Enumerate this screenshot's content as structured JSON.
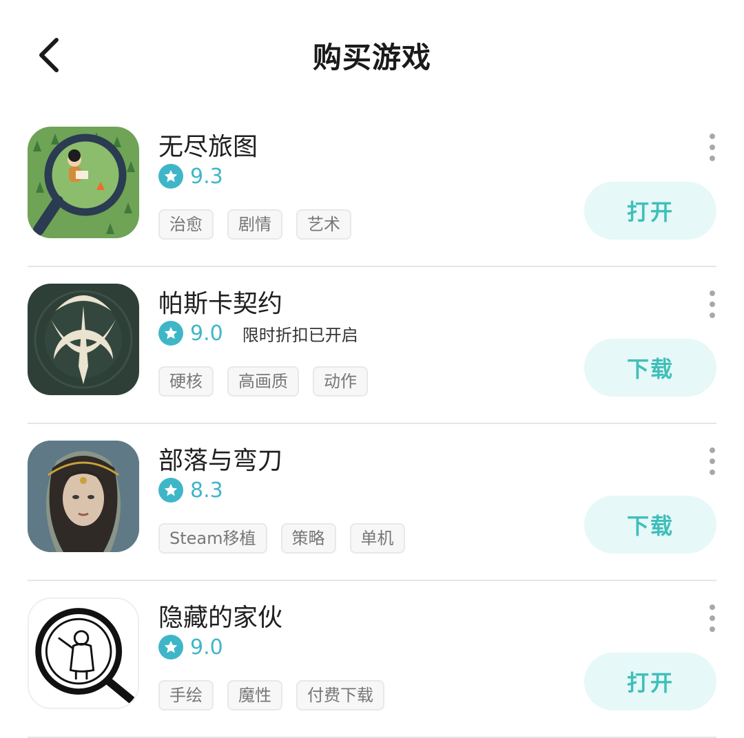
{
  "header": {
    "title": "购买游戏",
    "back_icon": "chevron-left-icon"
  },
  "accent_color": "#3fb6c8",
  "button_color": "#e6f8f8",
  "games": [
    {
      "name": "无尽旅图",
      "rating": "9.3",
      "promo": "",
      "tags": [
        "治愈",
        "剧情",
        "艺术"
      ],
      "action": "打开"
    },
    {
      "name": "帕斯卡契约",
      "rating": "9.0",
      "promo": "限时折扣已开启",
      "tags": [
        "硬核",
        "高画质",
        "动作"
      ],
      "action": "下载"
    },
    {
      "name": "部落与弯刀",
      "rating": "8.3",
      "promo": "",
      "tags": [
        "Steam移植",
        "策略",
        "单机"
      ],
      "action": "下载"
    },
    {
      "name": "隐藏的家伙",
      "rating": "9.0",
      "promo": "",
      "tags": [
        "手绘",
        "魔性",
        "付费下载"
      ],
      "action": "打开"
    }
  ]
}
